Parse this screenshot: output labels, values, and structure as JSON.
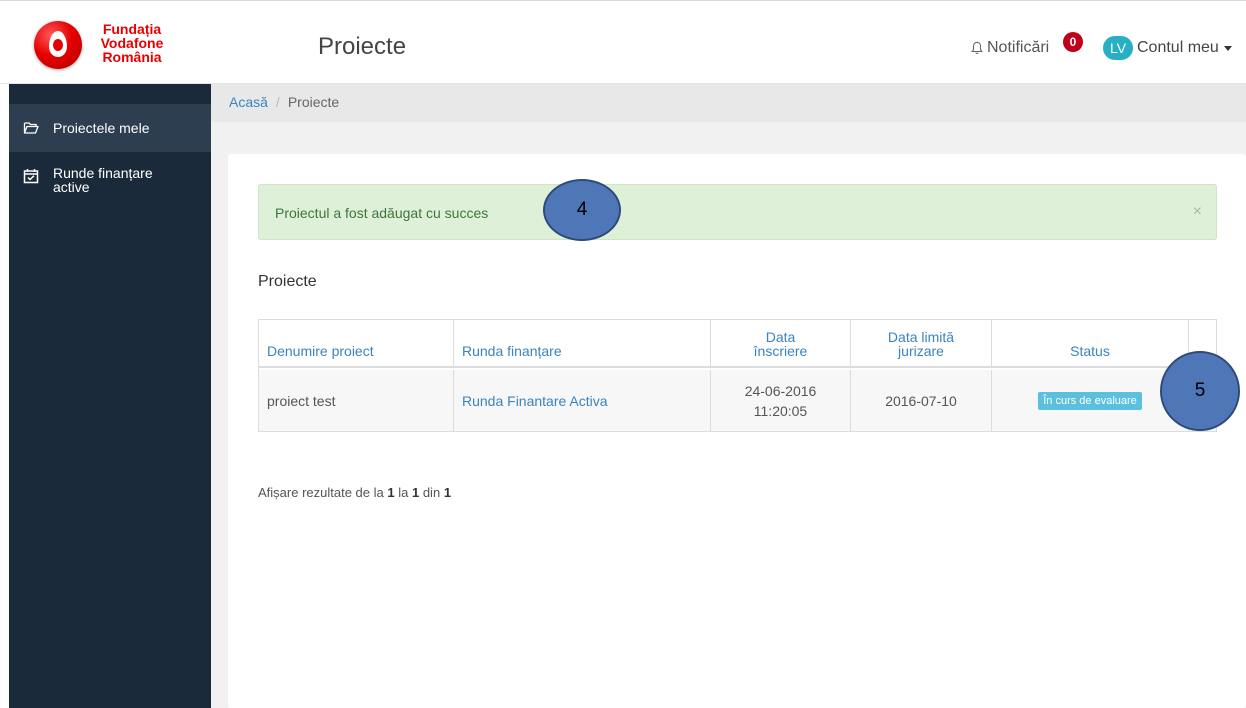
{
  "brand": {
    "line1": "Fundația",
    "line2": "Vodafone",
    "line3": "România",
    "color": "#e60000"
  },
  "header": {
    "title": "Proiecte",
    "notifications_label": "Notificări",
    "notifications_count": "0",
    "account_initials": "LV",
    "account_label": "Contul meu"
  },
  "sidebar": {
    "items": [
      {
        "label": "Proiectele mele",
        "icon": "folder-open-icon"
      },
      {
        "label": "Runde finanțare active",
        "icon": "calendar-check-icon"
      }
    ]
  },
  "breadcrumb": {
    "home": "Acasă",
    "current": "Proiecte"
  },
  "alert": {
    "message": "Proiectul a fost adăugat cu succes",
    "close": "×"
  },
  "section_title": "Proiecte",
  "table": {
    "headers": [
      "Denumire proiect",
      "Runda finanțare",
      "Data înscriere",
      "Data limită jurizare",
      "Status"
    ],
    "rows": [
      {
        "name": "proiect test",
        "round": "Runda Finantare Activa",
        "date_line1": "24-06-2016",
        "date_line2": "11:20:05",
        "deadline": "2016-07-10",
        "status": "În curs de evaluare"
      }
    ]
  },
  "pagination": {
    "prefix": "Afișare rezultate de la",
    "from": "1",
    "mid": "la",
    "to": "1",
    "of": "din",
    "total": "1"
  },
  "callouts": [
    "4",
    "5"
  ],
  "colors": {
    "sidebar": "#1b2a3a",
    "accent": "#3a84c0",
    "success_bg": "#dff0d8",
    "badge": "#5bc0de",
    "avatar": "#27b0c4"
  }
}
